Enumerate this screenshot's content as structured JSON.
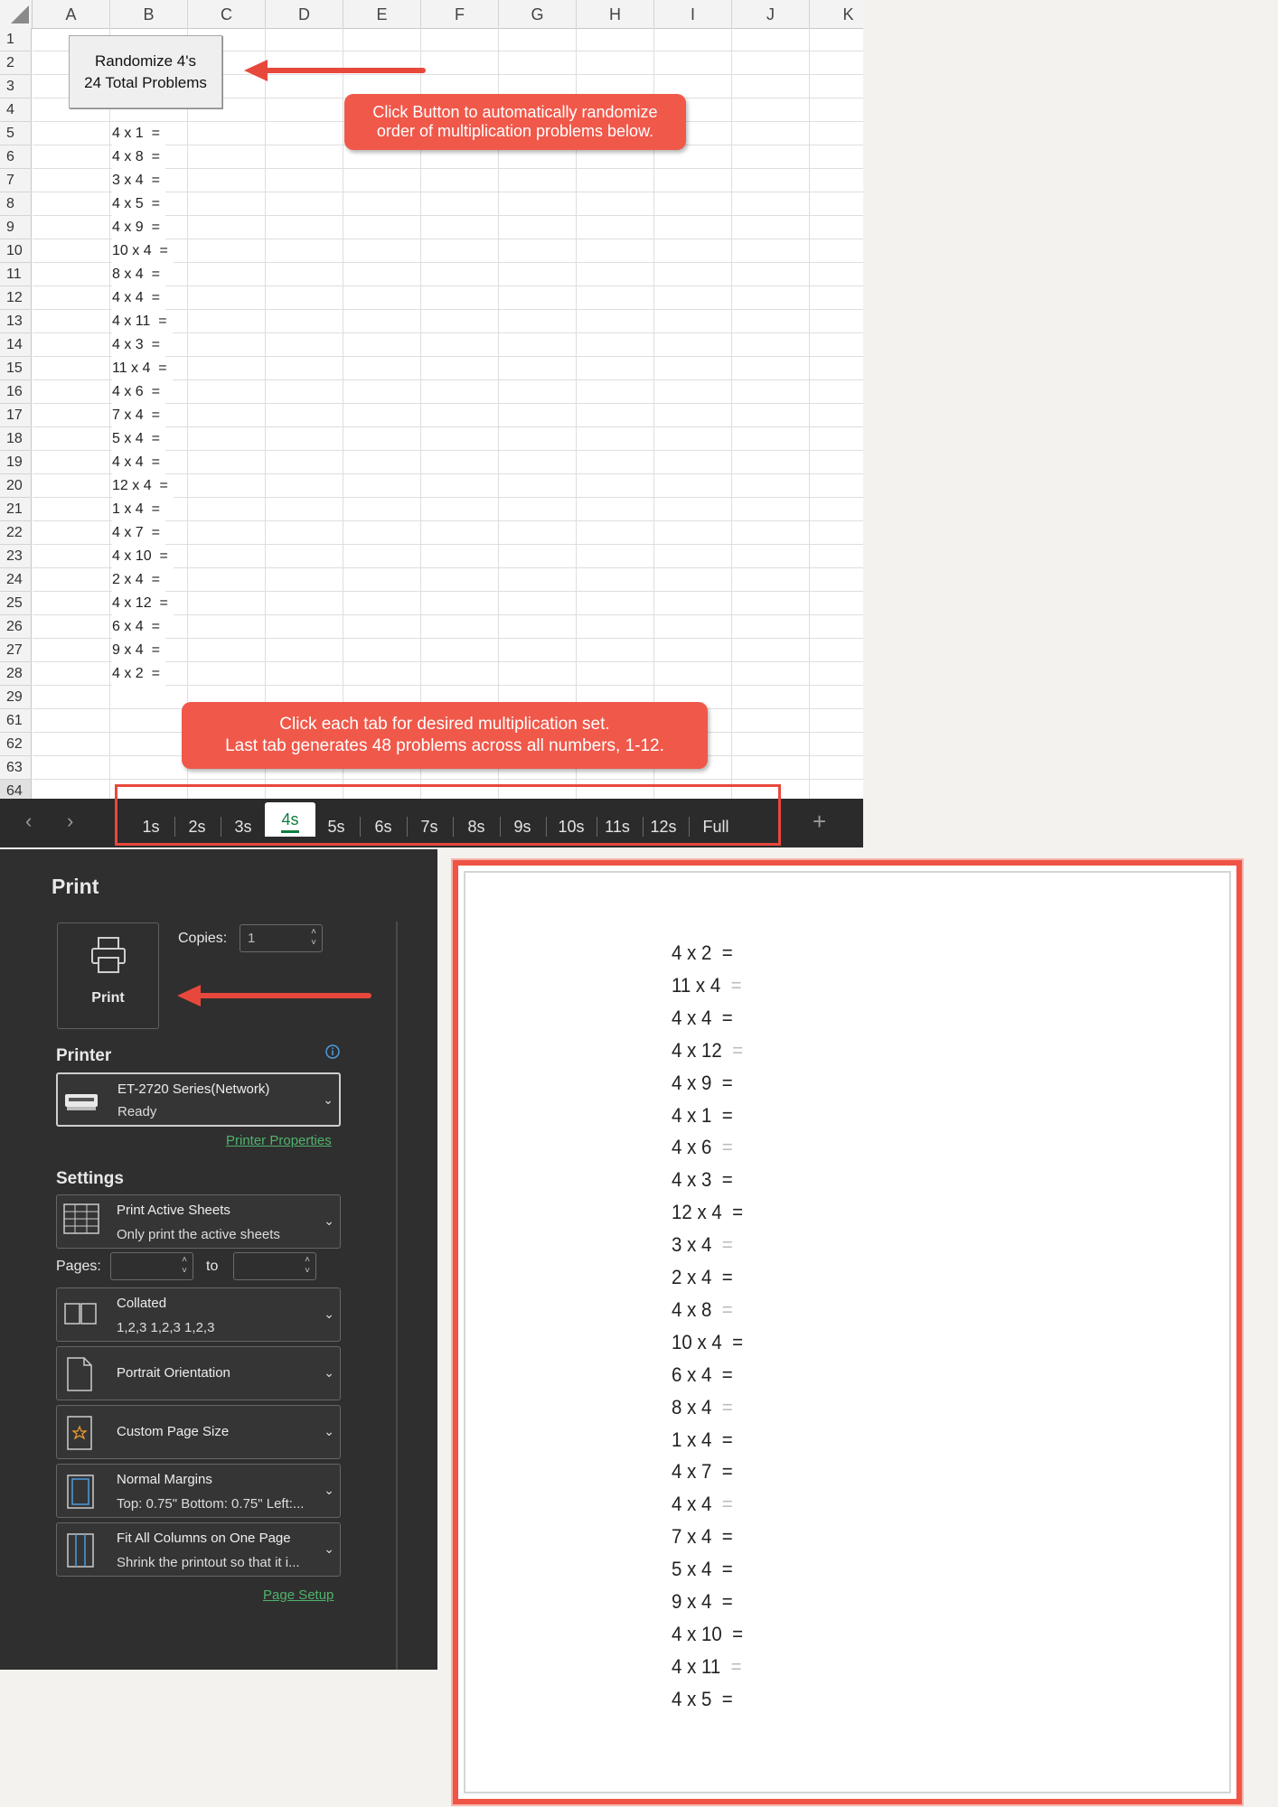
{
  "spreadsheet": {
    "columns": [
      "A",
      "B",
      "C",
      "D",
      "E",
      "F",
      "G",
      "H",
      "I",
      "J",
      "K"
    ],
    "rows": [
      "1",
      "2",
      "3",
      "4",
      "5",
      "6",
      "7",
      "8",
      "9",
      "10",
      "11",
      "12",
      "13",
      "14",
      "15",
      "16",
      "17",
      "18",
      "19",
      "20",
      "21",
      "22",
      "23",
      "24",
      "25",
      "26",
      "27",
      "28",
      "29",
      "61",
      "62",
      "63",
      "64"
    ],
    "selected_row": "64",
    "randomize_button": {
      "line1": "Randomize 4's",
      "line2": "24 Total Problems"
    },
    "problems": [
      "4 x 1  =",
      "4 x 8  =",
      "3 x 4  =",
      "4 x 5  =",
      "4 x 9  =",
      "10 x 4  =",
      "8 x 4  =",
      "4 x 4  =",
      "4 x 11  =",
      "4 x 3  =",
      "11 x 4  =",
      "4 x 6  =",
      "7 x 4  =",
      "5 x 4  =",
      "4 x 4  =",
      "12 x 4  =",
      "1 x 4  =",
      "4 x 7  =",
      "4 x 10  =",
      "2 x 4  =",
      "4 x 12  =",
      "6 x 4  =",
      "9 x 4  =",
      "4 x 2  ="
    ],
    "callout_button": {
      "line1": "Click Button to automatically randomize",
      "line2": "order of multiplication problems below."
    },
    "callout_tabs": {
      "line1": "Click each tab for desired multiplication set.",
      "line2": "Last tab generates 48 problems across all numbers, 1-12."
    },
    "tabs": [
      "1s",
      "2s",
      "3s",
      "4s",
      "5s",
      "6s",
      "7s",
      "8s",
      "9s",
      "10s",
      "11s",
      "12s",
      "Full"
    ],
    "active_tab": "4s",
    "nav_prev": "‹",
    "nav_next": "›",
    "add_sheet": "+"
  },
  "print_pane": {
    "title": "Print",
    "print_button": "Print",
    "copies_label": "Copies:",
    "copies_value": "1",
    "printer_section": "Printer",
    "printer_name": "ET-2720 Series(Network)",
    "printer_status": "Ready",
    "printer_properties": "Printer Properties",
    "settings_section": "Settings",
    "settings": [
      {
        "line1": "Print Active Sheets",
        "line2": "Only print the active sheets"
      },
      {
        "line1": "Collated",
        "line2": "1,2,3    1,2,3    1,2,3"
      },
      {
        "line1": "Portrait Orientation"
      },
      {
        "line1": "Custom Page Size"
      },
      {
        "line1": "Normal Margins",
        "line2": "Top: 0.75\" Bottom: 0.75\" Left:..."
      },
      {
        "line1": "Fit All Columns on One Page",
        "line2": "Shrink the printout so that it i..."
      }
    ],
    "pages_label": "Pages:",
    "pages_to": "to",
    "page_setup": "Page Setup"
  },
  "preview": {
    "problems": [
      "4 x 2",
      "11 x 4",
      "4 x 4",
      "4 x 12",
      "4 x 9",
      "4 x 1",
      "4 x 6",
      "4 x 3",
      "12 x 4",
      "3 x 4",
      "2 x 4",
      "4 x 8",
      "10 x 4",
      "6 x 4",
      "8 x 4",
      "1 x 4",
      "4 x 7",
      "4 x 4",
      "7 x 4",
      "5 x 4",
      "9 x 4",
      "4 x 10",
      "4 x 11",
      "4 x 5"
    ],
    "equals": "=",
    "faint_rows": [
      1,
      3,
      6,
      9,
      11,
      14,
      17,
      22
    ]
  },
  "colors": {
    "callout": "#f0584a",
    "excel_green": "#107c41",
    "highlight_border": "#e8483c",
    "link": "#4fb36d"
  }
}
